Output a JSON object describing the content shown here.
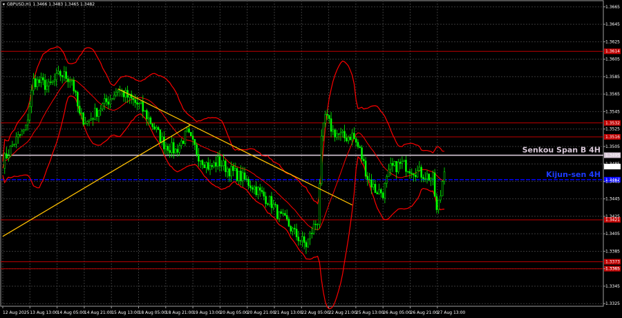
{
  "chart_data": {
    "type": "candlestick",
    "header": "GBPUSD,H1  1.3466 1.3483 1.3465 1.3482",
    "ylim": [
      1.3322,
      1.3672
    ],
    "y_ticks": [
      "1.3665",
      "1.3645",
      "1.3625",
      "1.3605",
      "1.3585",
      "1.3565",
      "1.3545",
      "1.3525",
      "1.3505",
      "1.3485",
      "1.3465",
      "1.3445",
      "1.3425",
      "1.3405",
      "1.3385",
      "1.3365",
      "1.3345",
      "1.3325"
    ],
    "x_ticks": [
      "12 Aug 2025",
      "13 Aug 13:00",
      "14 Aug 05:00",
      "14 Aug 21:00",
      "15 Aug 13:00",
      "18 Aug 05:00",
      "18 Aug 21:00",
      "19 Aug 13:00",
      "20 Aug 05:00",
      "20 Aug 21:00",
      "21 Aug 13:00",
      "22 Aug 05:00",
      "22 Aug 21:00",
      "25 Aug 13:00",
      "26 Aug 05:00",
      "26 Aug 21:00",
      "27 Aug 13:00"
    ],
    "current_price": "1.3482",
    "levels": [
      {
        "price": 1.3614,
        "label": "1.3614",
        "color": "#c00000"
      },
      {
        "price": 1.3532,
        "label": "1.3532",
        "color": "#c00000"
      },
      {
        "price": 1.3516,
        "label": "1.3516",
        "color": "#c00000"
      },
      {
        "price": 1.3495,
        "label": "1.3495",
        "color": "#d8c8d8",
        "annotation": "Senkou Span B 4H"
      },
      {
        "price": 1.3467,
        "label": "1.3467",
        "color": "#0000ff",
        "annotation": "Kijun-sen 4H"
      },
      {
        "price": 1.3421,
        "label": "1.3421",
        "color": "#c00000"
      },
      {
        "price": 1.3373,
        "label": "1.3373",
        "color": "#c00000"
      },
      {
        "price": 1.3365,
        "label": "1.3365",
        "color": "#c00000"
      }
    ],
    "trend_lines": [
      {
        "from": [
          0,
          1.3402
        ],
        "to": [
          98,
          1.353
        ]
      },
      {
        "from": [
          60,
          1.3571
        ],
        "to": [
          182,
          1.3438
        ]
      }
    ],
    "colors": {
      "bull": "#00ff00",
      "bear": "#00ff00",
      "band": "#ff0000",
      "trend": "#ffc000",
      "grid": "#3a3a3a",
      "bg": "#000000"
    },
    "path_points": [
      [
        0,
        1.3487
      ],
      [
        6,
        1.351
      ],
      [
        12,
        1.3525
      ],
      [
        16,
        1.358
      ],
      [
        20,
        1.3578
      ],
      [
        24,
        1.3573
      ],
      [
        30,
        1.3588
      ],
      [
        36,
        1.3582
      ],
      [
        40,
        1.354
      ],
      [
        44,
        1.3533
      ],
      [
        50,
        1.3548
      ],
      [
        56,
        1.356
      ],
      [
        60,
        1.3571
      ],
      [
        66,
        1.356
      ],
      [
        72,
        1.355
      ],
      [
        78,
        1.353
      ],
      [
        84,
        1.3508
      ],
      [
        90,
        1.35
      ],
      [
        96,
        1.352
      ],
      [
        102,
        1.3495
      ],
      [
        108,
        1.348
      ],
      [
        112,
        1.3488
      ],
      [
        118,
        1.3478
      ],
      [
        124,
        1.347
      ],
      [
        130,
        1.346
      ],
      [
        136,
        1.3448
      ],
      [
        140,
        1.344
      ],
      [
        144,
        1.3425
      ],
      [
        148,
        1.3418
      ],
      [
        152,
        1.3405
      ],
      [
        158,
        1.3392
      ],
      [
        162,
        1.3413
      ],
      [
        164,
        1.342
      ],
      [
        166,
        1.351
      ],
      [
        168,
        1.354
      ],
      [
        172,
        1.3522
      ],
      [
        178,
        1.3515
      ],
      [
        182,
        1.3518
      ],
      [
        186,
        1.35
      ],
      [
        190,
        1.347
      ],
      [
        194,
        1.3455
      ],
      [
        198,
        1.3452
      ],
      [
        202,
        1.348
      ],
      [
        208,
        1.3485
      ],
      [
        214,
        1.3478
      ],
      [
        220,
        1.3472
      ],
      [
        224,
        1.3468
      ],
      [
        226,
        1.343
      ],
      [
        228,
        1.345
      ],
      [
        230,
        1.3482
      ]
    ]
  }
}
